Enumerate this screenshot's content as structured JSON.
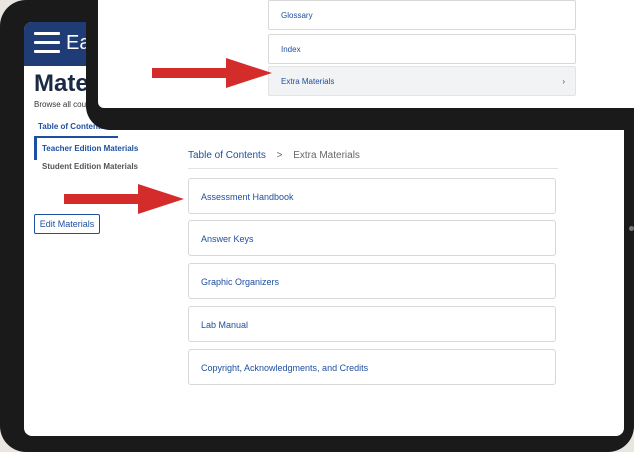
{
  "app": {
    "brand": "Ear"
  },
  "page": {
    "title": "Materi",
    "subtitle": "Browse all cours"
  },
  "sidebar": {
    "tab_label": "Table of Contents",
    "items": [
      {
        "label": "Teacher Edition Materials",
        "active": true
      },
      {
        "label": "Student Edition Materials",
        "active": false
      }
    ],
    "edit_button_label": "Edit Materials"
  },
  "breadcrumb": {
    "root": "Table of Contents",
    "separator": ">",
    "current": "Extra Materials"
  },
  "materials": [
    {
      "label": "Assessment Handbook"
    },
    {
      "label": "Answer Keys"
    },
    {
      "label": "Graphic Organizers"
    },
    {
      "label": "Lab Manual"
    },
    {
      "label": "Copyright, Acknowledgments, and Credits"
    }
  ],
  "overlay": {
    "items": [
      {
        "label": "Glossary"
      },
      {
        "label": "Index"
      },
      {
        "label": "Extra Materials",
        "chevron": "›"
      }
    ]
  },
  "colors": {
    "accent": "#1f4fa0",
    "topbar": "#1f3c77",
    "arrow": "#d42b2b"
  },
  "icons": {
    "menu": "hamburger-icon",
    "arrow": "red-arrow-icon",
    "chevron": "chevron-right-icon"
  }
}
